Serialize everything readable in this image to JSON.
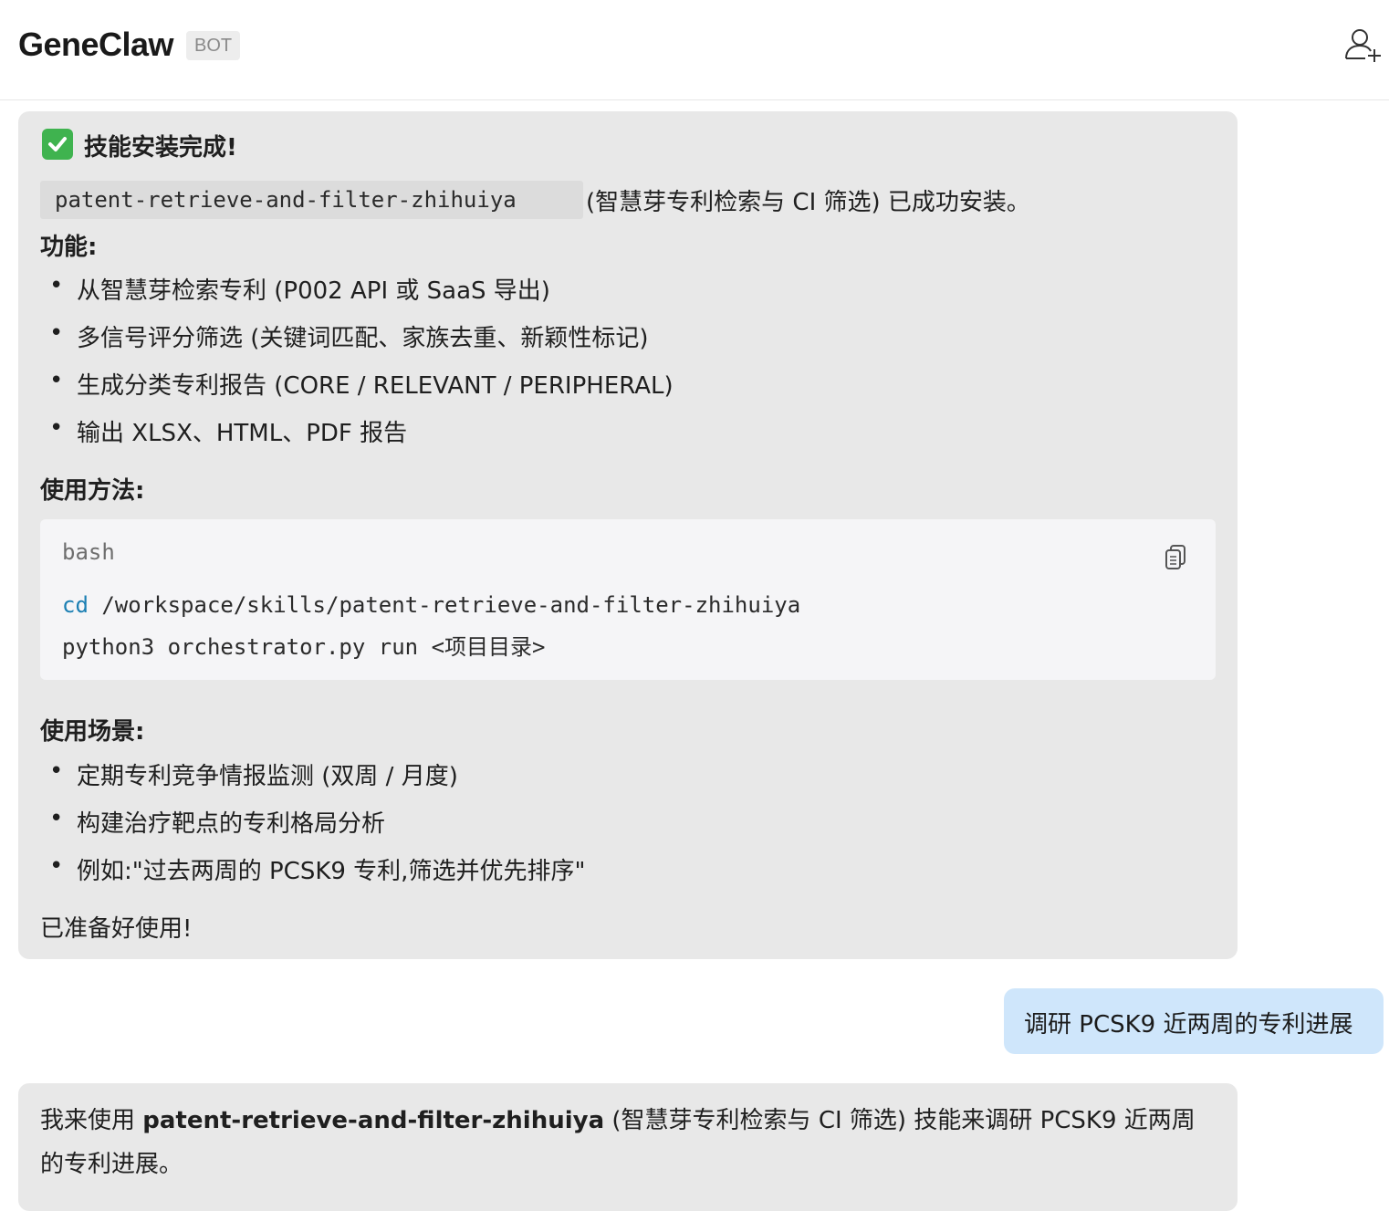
{
  "header": {
    "title": "GeneClaw",
    "badge": "BOT",
    "add_user_icon": "add-user-icon"
  },
  "message1": {
    "status_icon": "check-mark-icon",
    "heading": "技能安装完成!",
    "skill_code": "patent-retrieve-and-filter-zhihuiya",
    "install_text": "(智慧芽专利检索与 CI 筛选) 已成功安装。",
    "features_title": "功能:",
    "features": [
      "从智慧芽检索专利 (P002 API 或 SaaS 导出)",
      "多信号评分筛选 (关键词匹配、家族去重、新颖性标记)",
      "生成分类专利报告 (CORE / RELEVANT / PERIPHERAL)",
      "输出 XLSX、HTML、PDF 报告"
    ],
    "usage_title": "使用方法:",
    "code": {
      "lang": "bash",
      "copy_icon": "copy-icon",
      "line1_keyword": "cd",
      "line1_rest": " /workspace/skills/patent-retrieve-and-filter-zhihuiya",
      "line2": "python3 orchestrator.py run <项目目录>"
    },
    "scenarios_title": "使用场景:",
    "scenarios": [
      "定期专利竞争情报监测 (双周 / 月度)",
      "构建治疗靶点的专利格局分析",
      "例如:\"过去两周的 PCSK9 专利,筛选并优先排序\""
    ],
    "closing": "已准备好使用!"
  },
  "user_message": {
    "text": "调研 PCSK9 近两周的专利进展"
  },
  "message3": {
    "prefix": "我来使用 ",
    "skill_name": "patent-retrieve-and-filter-zhihuiya",
    "suffix": " (智慧芽专利检索与 CI 筛选) 技能来调研 PCSK9 近两周",
    "line2": "的专利进展。"
  }
}
